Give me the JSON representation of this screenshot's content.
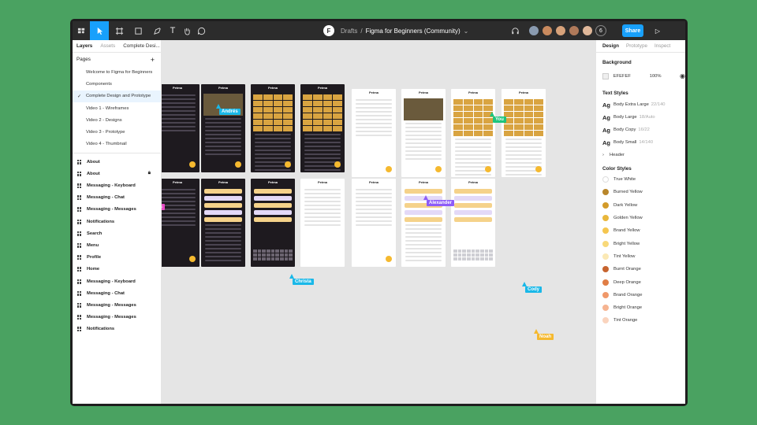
{
  "toolbar": {
    "breadcrumb_root": "Drafts",
    "separator": "/",
    "file_name": "Figma for Beginners (Community)",
    "collaborator_count": "6",
    "share_label": "Share",
    "avatar_colors": [
      "#8a9bb0",
      "#c98a5e",
      "#d7a27a",
      "#b07a5a",
      "#e0b89a"
    ]
  },
  "left_panel": {
    "tabs": [
      "Layers",
      "Assets",
      "Complete Desi..."
    ],
    "pages_title": "Pages",
    "pages": [
      {
        "label": "Welcome to Figma for Beginners",
        "selected": false
      },
      {
        "label": "Components",
        "selected": false
      },
      {
        "label": "Complete Design and Prototype",
        "selected": true
      },
      {
        "label": "Video 1 - Wireframes",
        "selected": false
      },
      {
        "label": "Video 2 - Designs",
        "selected": false
      },
      {
        "label": "Video 3 - Prototype",
        "selected": false
      },
      {
        "label": "Video 4 - Thumbnail",
        "selected": false
      }
    ],
    "layers": [
      {
        "label": "About",
        "locked": false
      },
      {
        "label": "About",
        "locked": true
      },
      {
        "label": "Messaging - Keyboard",
        "locked": false
      },
      {
        "label": "Messaging - Chat",
        "locked": false
      },
      {
        "label": "Messaging - Messages",
        "locked": false
      },
      {
        "label": "Notifications",
        "locked": false
      },
      {
        "label": "Search",
        "locked": false
      },
      {
        "label": "Menu",
        "locked": false
      },
      {
        "label": "Profile",
        "locked": false
      },
      {
        "label": "Home",
        "locked": false
      },
      {
        "label": "Messaging - Keyboard",
        "locked": false
      },
      {
        "label": "Messaging - Chat",
        "locked": false
      },
      {
        "label": "Messaging - Messages",
        "locked": false
      },
      {
        "label": "Messaging - Messages",
        "locked": false
      },
      {
        "label": "Notifications",
        "locked": false
      }
    ]
  },
  "canvas": {
    "frame_title": "Petma",
    "cursors": [
      {
        "name": "Andrés",
        "color": "#1ab8e8"
      },
      {
        "name": "You",
        "color": "#1bc47d"
      },
      {
        "name": "Alexander",
        "color": "#8e5cf7"
      },
      {
        "name": "Christa",
        "color": "#1ab8e8"
      },
      {
        "name": "Cody",
        "color": "#1ab8e8"
      },
      {
        "name": "Noah",
        "color": "#f5b92f"
      },
      {
        "name": "ra",
        "color": "#e84cc6"
      }
    ]
  },
  "right_panel": {
    "tabs": [
      "Design",
      "Prototype",
      "Inspect"
    ],
    "background_title": "Background",
    "background_hex": "EFEFEF",
    "background_opacity": "100%",
    "text_styles_title": "Text Styles",
    "text_styles": [
      {
        "name": "Body Extra Large",
        "meta": "22/140"
      },
      {
        "name": "Body Large",
        "meta": "18/Auto"
      },
      {
        "name": "Body Copy",
        "meta": "16/22"
      },
      {
        "name": "Body Small",
        "meta": "14/140"
      }
    ],
    "header_label": "Header",
    "color_styles_title": "Color Styles",
    "color_styles": [
      {
        "name": "True White",
        "color": "#ffffff"
      },
      {
        "name": "Burned Yellow",
        "color": "#b8862b"
      },
      {
        "name": "Dark Yellow",
        "color": "#d39b2a"
      },
      {
        "name": "Golden Yellow",
        "color": "#e9b73b"
      },
      {
        "name": "Brand Yellow",
        "color": "#f5c64f"
      },
      {
        "name": "Bright Yellow",
        "color": "#f8d979"
      },
      {
        "name": "Tint Yellow",
        "color": "#fbe9b5"
      },
      {
        "name": "Burnt Orange",
        "color": "#c7642f"
      },
      {
        "name": "Deep Orange",
        "color": "#e07d45"
      },
      {
        "name": "Brand Orange",
        "color": "#f0986a"
      },
      {
        "name": "Bright Orange",
        "color": "#f6b491"
      },
      {
        "name": "Tint Orange",
        "color": "#fad4be"
      }
    ]
  }
}
